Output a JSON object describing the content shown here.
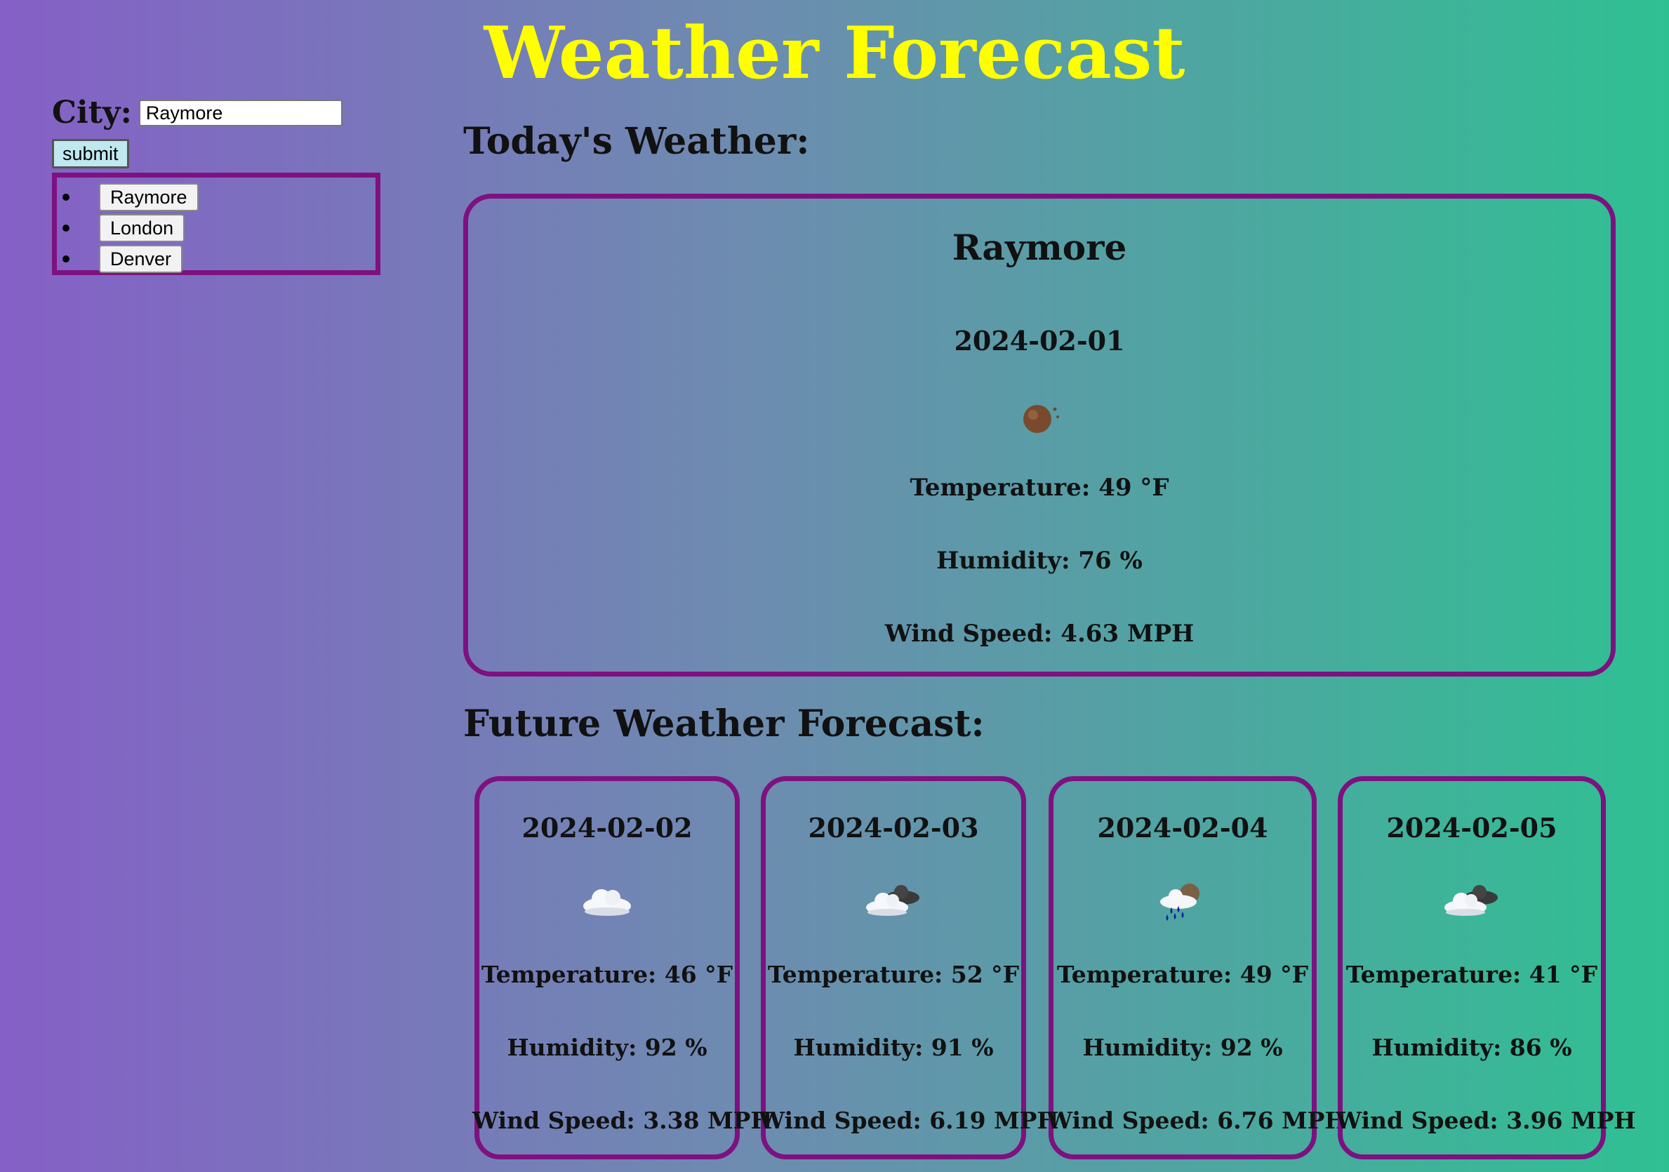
{
  "header": {
    "title": "Weather Forecast"
  },
  "search": {
    "label": "City:",
    "value": "Raymore",
    "submit_label": "submit",
    "history": [
      "Raymore",
      "London",
      "Denver"
    ]
  },
  "today": {
    "heading": "Today's Weather:",
    "city": "Raymore",
    "date": "2024-02-01",
    "icon": "mist-icon",
    "temperature": "Temperature: 49 °F",
    "humidity": "Humidity: 76 %",
    "wind": "Wind Speed: 4.63 MPH"
  },
  "forecast": {
    "heading": "Future Weather Forecast:",
    "days": [
      {
        "date": "2024-02-02",
        "icon": "cloud-icon",
        "temperature": "Temperature: 46 °F",
        "humidity": "Humidity: 92 %",
        "wind": "Wind Speed: 3.38 MPH"
      },
      {
        "date": "2024-02-03",
        "icon": "broken-clouds-icon",
        "temperature": "Temperature: 52 °F",
        "humidity": "Humidity: 91 %",
        "wind": "Wind Speed: 6.19 MPH"
      },
      {
        "date": "2024-02-04",
        "icon": "rain-icon",
        "temperature": "Temperature: 49 °F",
        "humidity": "Humidity: 92 %",
        "wind": "Wind Speed: 6.76 MPH"
      },
      {
        "date": "2024-02-05",
        "icon": "broken-clouds-icon",
        "temperature": "Temperature: 41 °F",
        "humidity": "Humidity: 86 %",
        "wind": "Wind Speed: 3.96 MPH"
      }
    ]
  }
}
